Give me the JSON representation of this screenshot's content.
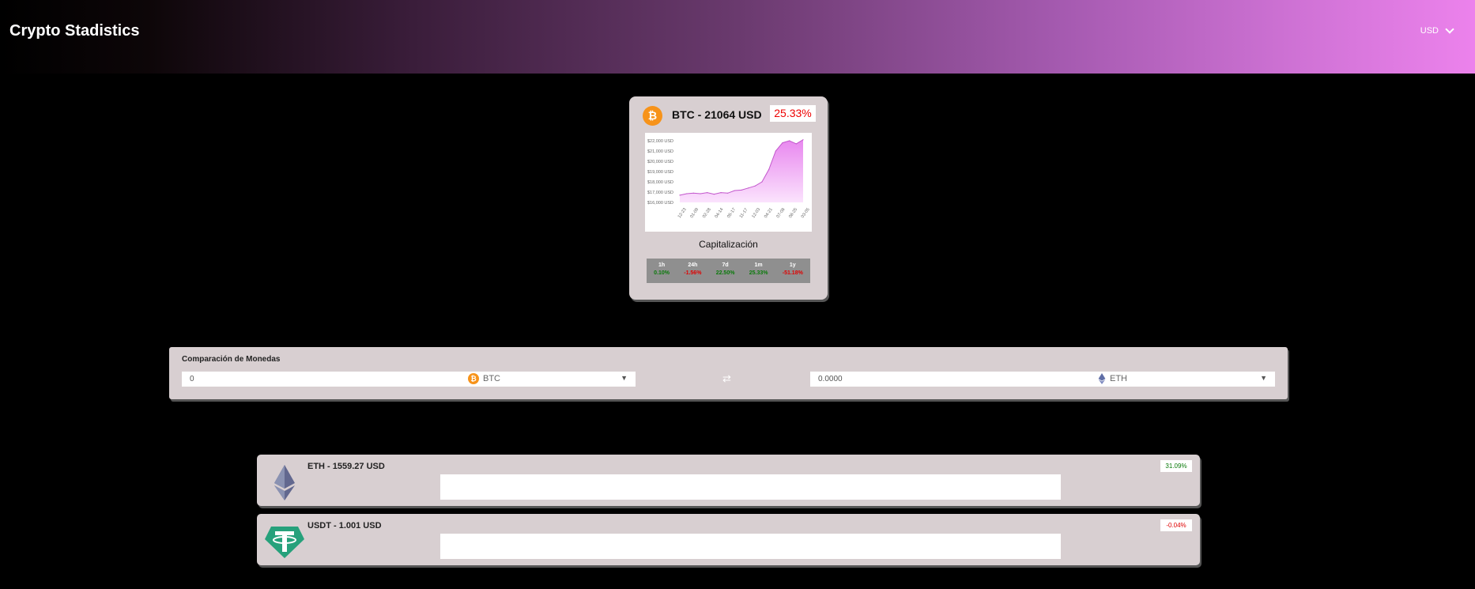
{
  "header": {
    "title": "Crypto Stadistics",
    "currency": "USD"
  },
  "btc_card": {
    "title": "BTC - 21064 USD",
    "change": "25.33%",
    "coin_symbol": "₿",
    "caption": "Capitalización",
    "stats": [
      {
        "label": "1h",
        "value": "0.10%",
        "trend": "pos"
      },
      {
        "label": "24h",
        "value": "-1.56%",
        "trend": "neg"
      },
      {
        "label": "7d",
        "value": "22.50%",
        "trend": "pos"
      },
      {
        "label": "1m",
        "value": "25.33%",
        "trend": "pos"
      },
      {
        "label": "1y",
        "value": "-51.18%",
        "trend": "neg"
      }
    ]
  },
  "chart_data": {
    "type": "area",
    "x": [
      "12-23",
      "01-09",
      "02-28",
      "04-14",
      "05-17",
      "11-17",
      "12-03",
      "04-21",
      "07-08",
      "08-25",
      "03-05"
    ],
    "values": [
      16700,
      16850,
      16900,
      16850,
      16950,
      16800,
      16950,
      16900,
      17150,
      17200,
      17400,
      17600,
      18000,
      19200,
      21000,
      21800,
      22000,
      21700,
      22100
    ],
    "yticks": [
      "$22,000 USD",
      "$21,000 USD",
      "$20,000 USD",
      "$19,000 USD",
      "$18,000 USD",
      "$17,000 USD",
      "$16,000 USD"
    ],
    "ylim": [
      16000,
      22000
    ],
    "color": "#e887ef"
  },
  "compare": {
    "title": "Comparación de Monedas",
    "left_value": "0",
    "left_coin": "BTC",
    "right_value": "0.0000",
    "right_coin": "ETH",
    "swap_symbol": "⇄",
    "arrow": "▼"
  },
  "coins": [
    {
      "name": "ETH - 1559.27 USD",
      "change": "31.09%",
      "trend": "pos"
    },
    {
      "name": "USDT - 1.001 USD",
      "change": "-0.04%",
      "trend": "neg"
    }
  ]
}
